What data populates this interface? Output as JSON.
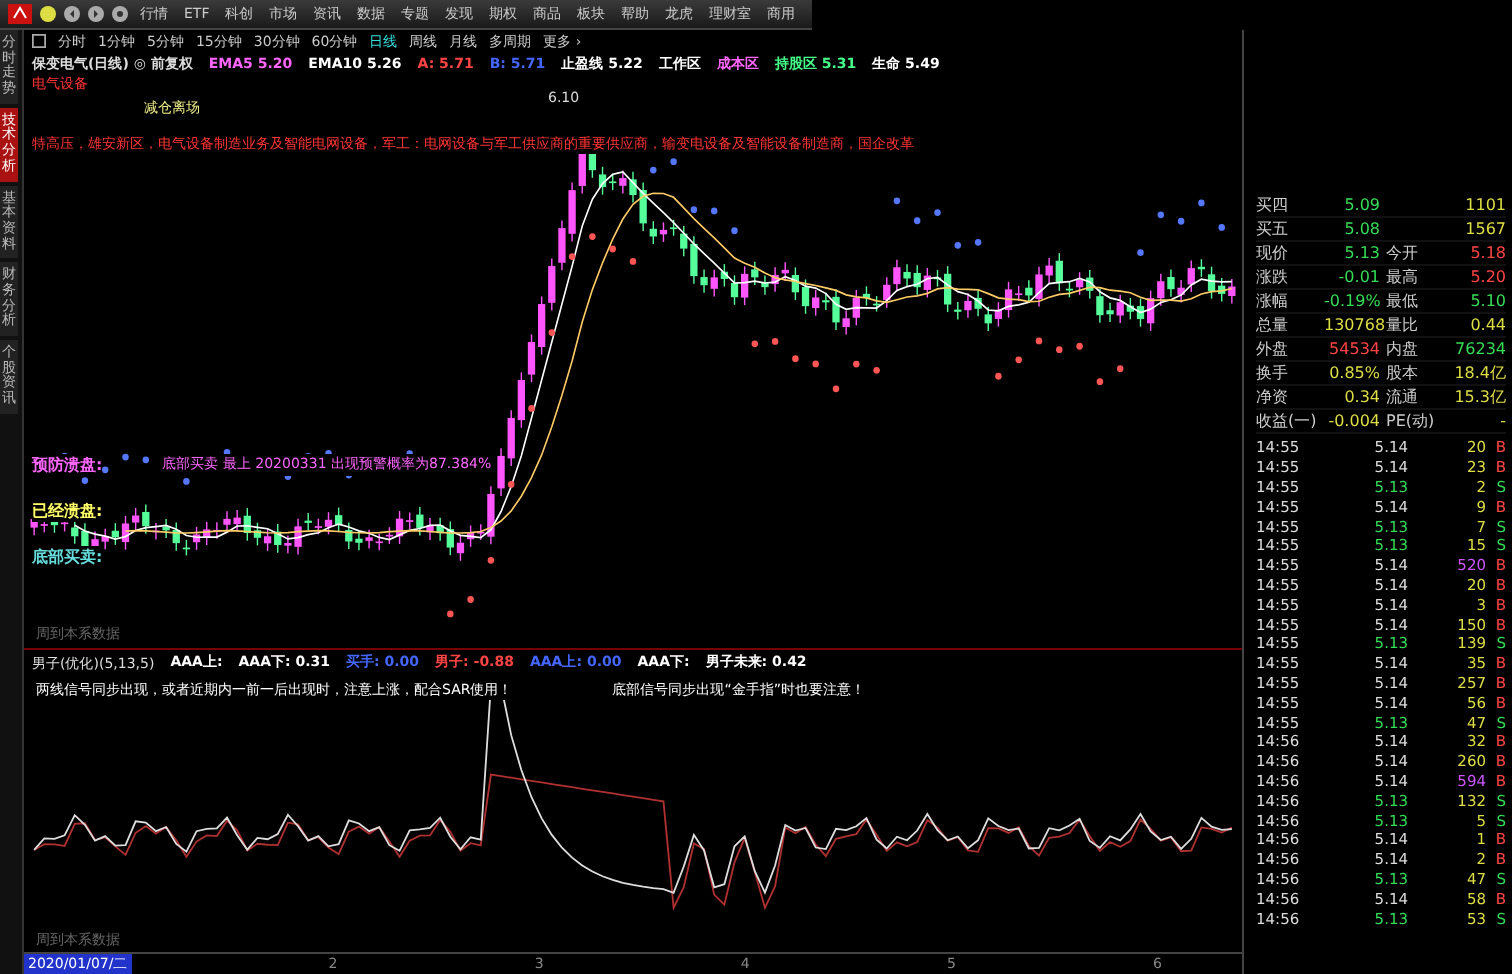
{
  "menu": [
    "行情",
    "ETF",
    "科创",
    "市场",
    "资讯",
    "数据",
    "专题",
    "发现",
    "期权",
    "商品",
    "板块",
    "帮助",
    "龙虎",
    "理财室",
    "商用"
  ],
  "side_tabs": [
    {
      "label": "分时走势",
      "selected": false
    },
    {
      "label": "技术分析",
      "selected": true
    },
    {
      "label": "基本资料",
      "selected": false
    },
    {
      "label": "财务分析",
      "selected": false
    },
    {
      "label": "个股资讯",
      "selected": false
    }
  ],
  "periods": [
    {
      "label": "分时",
      "selected": false
    },
    {
      "label": "1分钟",
      "selected": false
    },
    {
      "label": "5分钟",
      "selected": false
    },
    {
      "label": "15分钟",
      "selected": false
    },
    {
      "label": "30分钟",
      "selected": false
    },
    {
      "label": "60分钟",
      "selected": false
    },
    {
      "label": "日线",
      "selected": true
    },
    {
      "label": "周线",
      "selected": false
    },
    {
      "label": "月线",
      "selected": false
    },
    {
      "label": "多周期",
      "selected": false
    },
    {
      "label": "更多 ›",
      "selected": false
    }
  ],
  "info": [
    {
      "text": "保变电气(日线) ◎ 前复权",
      "color": "#dddddd"
    },
    {
      "text": "EMA5 5.20",
      "color": "#ff66ff"
    },
    {
      "text": "EMA10 5.26",
      "color": "#ffffff"
    },
    {
      "text": "A: 5.71",
      "color": "#ff4444"
    },
    {
      "text": "B: 5.71",
      "color": "#4466ff"
    },
    {
      "text": "止盈线 5.22",
      "color": "#ffffff"
    },
    {
      "text": "工作区",
      "color": "#ffffff"
    },
    {
      "text": "成本区",
      "color": "#ff66ff"
    },
    {
      "text": "持股区 5.31",
      "color": "#44ff88"
    },
    {
      "text": "生命 5.49",
      "color": "#ffffff"
    }
  ],
  "sector": "电气设备",
  "signal_note": "减仓离场",
  "concepts": "特高压，雄安新区，电气设备制造业务及智能电网设备，军工：电网设备与军工供应商的重要供应商，输变电设备及智能设备制造商，国企改革",
  "high_label": "6.10",
  "overlays": [
    {
      "label": "预防溃盘:",
      "note": "底部买卖 最上 20200331 出现预警概率为87.384%",
      "color": "#ff66ff"
    },
    {
      "label": "已经溃盘:",
      "color": "#ffff66"
    },
    {
      "label": "底部买卖:",
      "color": "#66dddd"
    }
  ],
  "upper_footer": "周到本系数据",
  "indicator": {
    "title": "男子(优化)(5,13,5)",
    "values": [
      {
        "text": "AAA上:",
        "color": "#ffffff"
      },
      {
        "text": "AAA下: 0.31",
        "color": "#ffffff"
      },
      {
        "text": "买手: 0.00",
        "color": "#4466ff"
      },
      {
        "text": "男子: -0.88",
        "color": "#ff4444"
      },
      {
        "text": "AAA上: 0.00",
        "color": "#4466ff"
      },
      {
        "text": "AAA下:",
        "color": "#ffffff"
      },
      {
        "text": "男子未来: 0.42",
        "color": "#ffffff"
      }
    ],
    "notes": [
      "两线信号同步出现，或者近期内一前一后出现时，注意上涨，配合SAR使用！",
      "底部信号同步出现“金手指”时也要注意！"
    ],
    "footer": "周到本系数据"
  },
  "date_axis": {
    "current": "2020/01/07/二",
    "months": [
      "2",
      "3",
      "4",
      "5",
      "6"
    ]
  },
  "quotes": [
    {
      "l1": "买四",
      "v1": {
        "text": "5.09",
        "color": "#33dd55"
      },
      "v2": {
        "text": "1101",
        "color": "#dddd44"
      }
    },
    {
      "l1": "买五",
      "v1": {
        "text": "5.08",
        "color": "#33dd55"
      },
      "v2": {
        "text": "1567",
        "color": "#dddd44"
      }
    },
    {
      "l1": "现价",
      "v1": {
        "text": "5.13",
        "color": "#33dd55"
      },
      "l2": "今开",
      "v2": {
        "text": "5.18",
        "color": "#ff4444"
      }
    },
    {
      "l1": "涨跌",
      "v1": {
        "text": "-0.01",
        "color": "#33dd55"
      },
      "l2": "最高",
      "v2": {
        "text": "5.20",
        "color": "#ff4444"
      }
    },
    {
      "l1": "涨幅",
      "v1": {
        "text": "-0.19%",
        "color": "#33dd55"
      },
      "l2": "最低",
      "v2": {
        "text": "5.10",
        "color": "#33dd55"
      }
    },
    {
      "l1": "总量",
      "v1": {
        "text": "130768",
        "color": "#dddd44"
      },
      "l2": "量比",
      "v2": {
        "text": "0.44",
        "color": "#dddd44"
      }
    },
    {
      "l1": "外盘",
      "v1": {
        "text": "54534",
        "color": "#ff4444"
      },
      "l2": "内盘",
      "v2": {
        "text": "76234",
        "color": "#33dd55"
      }
    },
    {
      "l1": "换手",
      "v1": {
        "text": "0.85%",
        "color": "#dddd44"
      },
      "l2": "股本",
      "v2": {
        "text": "18.4亿",
        "color": "#dddd44"
      }
    },
    {
      "l1": "净资",
      "v1": {
        "text": "0.34",
        "color": "#dddd44"
      },
      "l2": "流通",
      "v2": {
        "text": "15.3亿",
        "color": "#dddd44"
      }
    },
    {
      "l1": "收益(一)",
      "v1": {
        "text": "-0.004",
        "color": "#dddd44"
      },
      "l2": "PE(动)",
      "v2": {
        "text": "-",
        "color": "#dddd44"
      }
    }
  ],
  "ticks": [
    {
      "time": "14:55",
      "price": {
        "text": "5.14",
        "color": "#dddddd"
      },
      "volume": "20",
      "large": false,
      "side": {
        "text": "B",
        "color": "#ff4444"
      }
    },
    {
      "time": "14:55",
      "price": {
        "text": "5.14",
        "color": "#dddddd"
      },
      "volume": "23",
      "large": false,
      "side": {
        "text": "B",
        "color": "#ff4444"
      }
    },
    {
      "time": "14:55",
      "price": {
        "text": "5.13",
        "color": "#33dd55"
      },
      "volume": "2",
      "large": false,
      "side": {
        "text": "S",
        "color": "#33dd55"
      }
    },
    {
      "time": "14:55",
      "price": {
        "text": "5.14",
        "color": "#dddddd"
      },
      "volume": "9",
      "large": false,
      "side": {
        "text": "B",
        "color": "#ff4444"
      }
    },
    {
      "time": "14:55",
      "price": {
        "text": "5.13",
        "color": "#33dd55"
      },
      "volume": "7",
      "large": false,
      "side": {
        "text": "S",
        "color": "#33dd55"
      }
    },
    {
      "time": "14:55",
      "price": {
        "text": "5.13",
        "color": "#33dd55"
      },
      "volume": "15",
      "large": false,
      "side": {
        "text": "S",
        "color": "#33dd55"
      }
    },
    {
      "time": "14:55",
      "price": {
        "text": "5.14",
        "color": "#dddddd"
      },
      "volume": "520",
      "large": true,
      "side": {
        "text": "B",
        "color": "#ff4444"
      }
    },
    {
      "time": "14:55",
      "price": {
        "text": "5.14",
        "color": "#dddddd"
      },
      "volume": "20",
      "large": false,
      "side": {
        "text": "B",
        "color": "#ff4444"
      }
    },
    {
      "time": "14:55",
      "price": {
        "text": "5.14",
        "color": "#dddddd"
      },
      "volume": "3",
      "large": false,
      "side": {
        "text": "B",
        "color": "#ff4444"
      }
    },
    {
      "time": "14:55",
      "price": {
        "text": "5.14",
        "color": "#dddddd"
      },
      "volume": "150",
      "large": false,
      "side": {
        "text": "B",
        "color": "#ff4444"
      }
    },
    {
      "time": "14:55",
      "price": {
        "text": "5.13",
        "color": "#33dd55"
      },
      "volume": "139",
      "large": false,
      "side": {
        "text": "S",
        "color": "#33dd55"
      }
    },
    {
      "time": "14:55",
      "price": {
        "text": "5.14",
        "color": "#dddddd"
      },
      "volume": "35",
      "large": false,
      "side": {
        "text": "B",
        "color": "#ff4444"
      }
    },
    {
      "time": "14:55",
      "price": {
        "text": "5.14",
        "color": "#dddddd"
      },
      "volume": "257",
      "large": false,
      "side": {
        "text": "B",
        "color": "#ff4444"
      }
    },
    {
      "time": "14:55",
      "price": {
        "text": "5.14",
        "color": "#dddddd"
      },
      "volume": "56",
      "large": false,
      "side": {
        "text": "B",
        "color": "#ff4444"
      }
    },
    {
      "time": "14:55",
      "price": {
        "text": "5.13",
        "color": "#33dd55"
      },
      "volume": "47",
      "large": false,
      "side": {
        "text": "S",
        "color": "#33dd55"
      }
    },
    {
      "time": "14:56",
      "price": {
        "text": "5.14",
        "color": "#dddddd"
      },
      "volume": "32",
      "large": false,
      "side": {
        "text": "B",
        "color": "#ff4444"
      }
    },
    {
      "time": "14:56",
      "price": {
        "text": "5.14",
        "color": "#dddddd"
      },
      "volume": "260",
      "large": false,
      "side": {
        "text": "B",
        "color": "#ff4444"
      }
    },
    {
      "time": "14:56",
      "price": {
        "text": "5.14",
        "color": "#dddddd"
      },
      "volume": "594",
      "large": true,
      "side": {
        "text": "B",
        "color": "#ff4444"
      }
    },
    {
      "time": "14:56",
      "price": {
        "text": "5.13",
        "color": "#33dd55"
      },
      "volume": "132",
      "large": false,
      "side": {
        "text": "S",
        "color": "#33dd55"
      }
    },
    {
      "time": "14:56",
      "price": {
        "text": "5.13",
        "color": "#33dd55"
      },
      "volume": "5",
      "large": false,
      "side": {
        "text": "S",
        "color": "#33dd55"
      }
    },
    {
      "time": "14:56",
      "price": {
        "text": "5.14",
        "color": "#dddddd"
      },
      "volume": "1",
      "large": false,
      "side": {
        "text": "B",
        "color": "#ff4444"
      }
    },
    {
      "time": "14:56",
      "price": {
        "text": "5.14",
        "color": "#dddddd"
      },
      "volume": "2",
      "large": false,
      "side": {
        "text": "B",
        "color": "#ff4444"
      }
    },
    {
      "time": "14:56",
      "price": {
        "text": "5.13",
        "color": "#33dd55"
      },
      "volume": "47",
      "large": false,
      "side": {
        "text": "S",
        "color": "#33dd55"
      }
    },
    {
      "time": "14:56",
      "price": {
        "text": "5.14",
        "color": "#dddddd"
      },
      "volume": "58",
      "large": false,
      "side": {
        "text": "B",
        "color": "#ff4444"
      }
    },
    {
      "time": "14:56",
      "price": {
        "text": "5.13",
        "color": "#33dd55"
      },
      "volume": "53",
      "large": false,
      "side": {
        "text": "S",
        "color": "#33dd55"
      }
    }
  ]
}
